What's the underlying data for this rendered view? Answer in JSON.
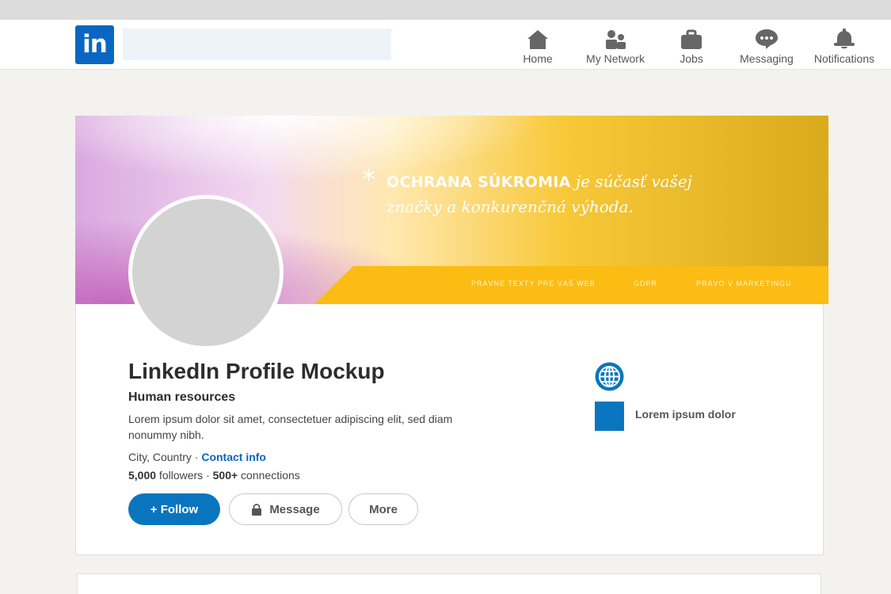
{
  "navbar": {
    "logo_text": "in",
    "search": {
      "placeholder": ""
    },
    "items": [
      {
        "label": "Home",
        "icon": "home-icon"
      },
      {
        "label": "My Network",
        "icon": "people-icon"
      },
      {
        "label": "Jobs",
        "icon": "briefcase-icon"
      },
      {
        "label": "Messaging",
        "icon": "chat-bubble-icon"
      },
      {
        "label": "Notifications",
        "icon": "bell-icon"
      }
    ]
  },
  "banner": {
    "headline_bold": "OCHRANA SÚKROMIA",
    "headline_italic_1": "je súčasť vašej",
    "headline_italic_2": "značky a konkurenčná výhoda.",
    "links": [
      "PRÁVNE TEXTY PRE VÁŠ WEB",
      "GDPR",
      "PRÁVO V MARKETINGU"
    ],
    "colors": {
      "pink": "#c26fc0",
      "white_glow": "#ffffff",
      "yellow": "#f7c325",
      "gold": "#d8aa1e",
      "stripe": "#fbbc13"
    }
  },
  "profile": {
    "name": "LinkedIn Profile Mockup",
    "headline": "Human resources",
    "about": "Lorem ipsum dolor sit amet, consectetuer adipiscing elit, sed diam nonummy nibh.",
    "location": "City, Country",
    "location_separator": " · ",
    "contact_link": "Contact info",
    "followers_count": "5,000",
    "followers_label": " followers · ",
    "connections_count": "500+",
    "connections_label": " connections"
  },
  "actions": {
    "follow_label": "+ Follow",
    "message_label": "Message",
    "more_label": "More"
  },
  "sidebar": {
    "website_icon": "globe-icon",
    "company_name": "Lorem ipsum dolor"
  },
  "colors": {
    "brand_blue": "#0a66c2",
    "button_blue": "#0a75bf",
    "page_bg": "#f3f2ef"
  }
}
